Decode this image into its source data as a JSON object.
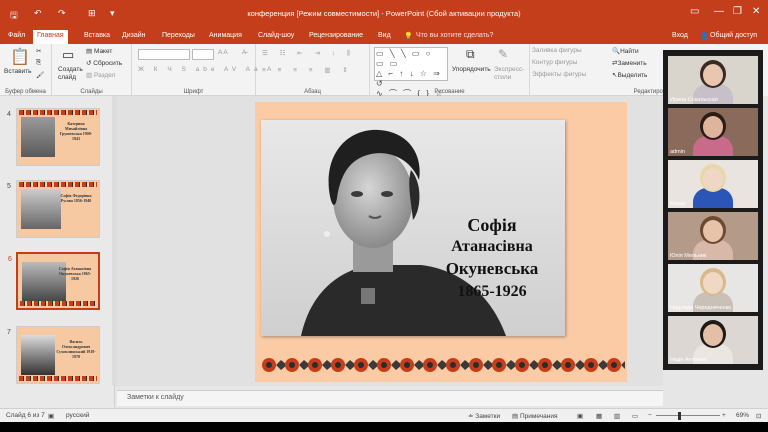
{
  "window": {
    "title": "конференция [Режим совместимости] - PowerPoint (Сбой активации продукта)",
    "signin": "Вход",
    "share": "Общий доступ",
    "min": "—",
    "max": "❐",
    "close": "✕"
  },
  "tabs": [
    "Файл",
    "Главная",
    "Вставка",
    "Дизайн",
    "Переходы",
    "Анимация",
    "Слайд-шоу",
    "Рецензирование",
    "Вид"
  ],
  "tell": "Что вы хотите сделать?",
  "ribbon": {
    "clipboard": {
      "paste": "Вставить",
      "label": "Буфер обмена"
    },
    "slides": {
      "new": "Создать слайд",
      "layout": "Макет",
      "reset": "Сбросить",
      "section": "Раздел",
      "label": "Слайды"
    },
    "font": {
      "label": "Шрифт",
      "size": "A A"
    },
    "paragraph": {
      "label": "Абзац"
    },
    "drawing": {
      "arrange": "Упорядочить",
      "styles": "Экспресс-стили",
      "fill": "Заливка фигуры",
      "outline": "Контур фигуры",
      "effects": "Эффекты фигуры",
      "label": "Рисование"
    },
    "editing": {
      "find": "Найти",
      "replace": "Заменить",
      "select": "Выделить",
      "label": "Редактирование"
    }
  },
  "thumbs": [
    {
      "num": "4",
      "caption": "Катерина Михайлівна Грушевська 1900-1943",
      "selected": false
    },
    {
      "num": "5",
      "caption": "Софія Федорівна Русова 1856-1940",
      "selected": false
    },
    {
      "num": "6",
      "caption": "Софія Атанасівна Окуневська 1865-1926",
      "selected": true
    },
    {
      "num": "7",
      "caption": "Василь Олександрович Сухомлинський 1918-1970",
      "selected": false
    }
  ],
  "slide": {
    "line1": "Софія",
    "line2": "Атанасівна",
    "line3": "Окуневська",
    "line4": "1865-1926"
  },
  "notes": "Заметки к слайду",
  "status": {
    "slide": "Слайд 6 из 7",
    "lang": "русский",
    "notes": "Заметки",
    "comments": "Примечания",
    "zoom": "69%",
    "zoom_value": 0.69
  },
  "participants": [
    {
      "name": "Ирина Сокальская",
      "hair": "#3a2a22",
      "skin": "#e9c6b0",
      "cloth": "#c8c0c8",
      "bg": "#d9d4cc"
    },
    {
      "name": "admin",
      "hair": "#2a1d18",
      "skin": "#deb59c",
      "cloth": "#c86a8a",
      "bg": "#8a6a5a"
    },
    {
      "name": "Маша",
      "hair": "#e8d7a8",
      "skin": "#f0d6c4",
      "cloth": "#2c55b8",
      "bg": "#e9e4e0"
    },
    {
      "name": "Юлія Мельник",
      "hair": "#6b4a30",
      "skin": "#e7c3aa",
      "cloth": "#d8b8a8",
      "bg": "#b49a88"
    },
    {
      "name": "Надежда Чередниченко",
      "hair": "#d9b98a",
      "skin": "#f0d8c4",
      "cloth": "#c9c0b8",
      "bg": "#e8e6e4"
    },
    {
      "name": "Надя Антонюк",
      "hair": "#1e1a18",
      "skin": "#e3bfa6",
      "cloth": "#eae6e2",
      "bg": "#dcd7d2"
    }
  ],
  "colors": {
    "accent": "#c43e1c",
    "slide_bg": "#fbcba5"
  }
}
